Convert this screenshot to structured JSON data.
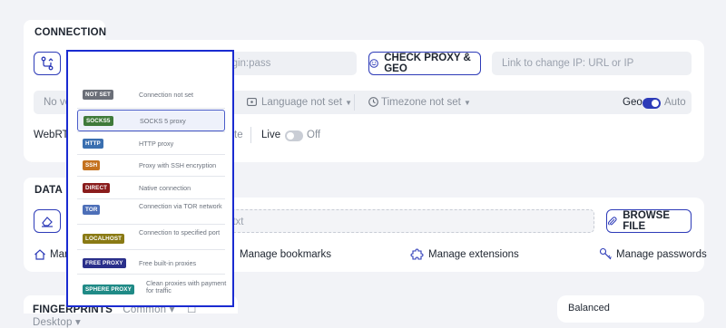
{
  "connection": {
    "section_title": "CONNECTION",
    "proxy_type": "Socks5",
    "proxy_input_placeholder": "ip:port@login:pass",
    "check_button": "CHECK PROXY & GEO",
    "change_ip_placeholder": "Link to change IP: URL or IP",
    "row2": {
      "verification_partial": "No veri",
      "language": "Language not set",
      "timezone": "Timezone not set",
      "geo_label": "Geo",
      "geo_value": "Auto"
    },
    "row3": {
      "webrtc_label": "WebRTC",
      "webrtc_partial": "te",
      "live_label": "Live",
      "live_value": "Off"
    },
    "dropdown": {
      "items": [
        {
          "badge": "NOT SET",
          "desc": "Connection not set",
          "color": "#6b6f78"
        },
        {
          "badge": "SOCKS5",
          "desc": "SOCKS 5 proxy",
          "color": "#3f7a3a",
          "selected": true
        },
        {
          "badge": "HTTP",
          "desc": "HTTP proxy",
          "color": "#3a6fb0"
        },
        {
          "badge": "SSH",
          "desc": "Proxy with SSH encryption",
          "color": "#c4721f"
        },
        {
          "badge": "DIRECT",
          "desc": "Native connection",
          "color": "#8a1c1c"
        },
        {
          "badge": "TOR",
          "desc": "Connection via TOR network",
          "color": "#4d6fb8"
        },
        {
          "badge": "LOCALHOST",
          "desc": "Connection to specified port",
          "color": "#8a7a14"
        },
        {
          "badge": "FREE PROXY",
          "desc": "Free built-in proxies",
          "color": "#2a2f8a"
        },
        {
          "badge": "SPHERE PROXY",
          "desc": "Clean proxies with payment for traffic",
          "color": "#1f8a86"
        }
      ]
    }
  },
  "data": {
    "section_title": "DATA",
    "file_placeholder": "se/txt",
    "browse_button": "BROWSE FILE",
    "manage_partial": "Mana",
    "manage_bookmarks": "Manage bookmarks",
    "manage_extensions": "Manage extensions",
    "manage_passwords": "Manage passwords"
  },
  "fingerprints": {
    "section_title_partial": "FINGERPRINTS",
    "common": "Common",
    "desktop": "Desktop",
    "balanced": "Balanced"
  },
  "colors": {
    "accent": "#2d3bb8",
    "toggle_on": "#2d3bb8",
    "toggle_off": "#c9cdd5",
    "highlight_border": "#1a2bd1"
  }
}
